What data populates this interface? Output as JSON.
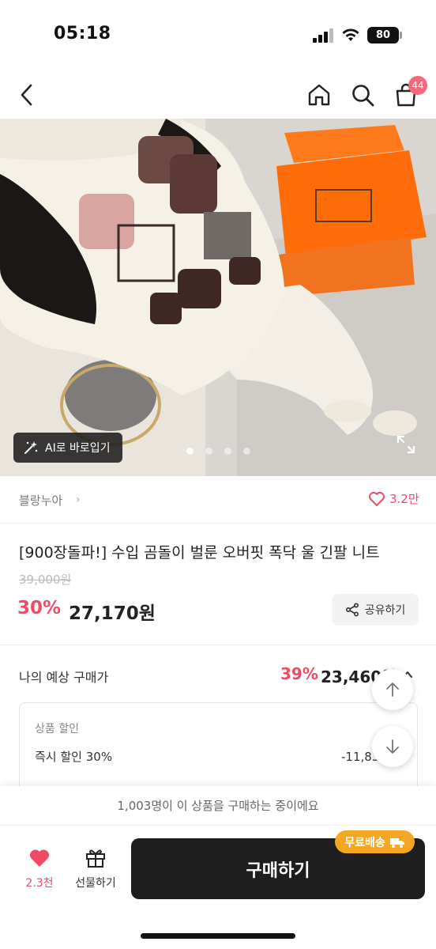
{
  "status_bar": {
    "time": "05:18",
    "battery": "80"
  },
  "header": {
    "back_icon": "chevron-left-icon",
    "home_icon": "home-icon",
    "search_icon": "search-icon",
    "cart_icon": "shopping-bag-icon",
    "cart_badge": "44"
  },
  "image": {
    "ai_button_label": "AI로 바로입기",
    "ai_icon": "magic-wand-icon",
    "carousel_total": 4,
    "carousel_active": 1,
    "expand_icon": "expand-icon"
  },
  "brand": {
    "name": "블랑누아",
    "chevron": "›",
    "like_count": "3.2만",
    "like_icon": "heart-outline-icon"
  },
  "product": {
    "title": "[900장돌파!] 수입 곰돌이 벌룬 오버핏 폭닥 울 긴팔 니트",
    "original_price": "39,000원",
    "discount": "30%",
    "price": "27,170원",
    "share_label": "공유하기"
  },
  "expected": {
    "label": "나의 예상 구매가",
    "discount": "39%",
    "price": "23,460원"
  },
  "discount_detail": {
    "section_title": "상품 할인",
    "items": [
      {
        "label": "즉시 할인 30%",
        "amount": "-11,830원"
      }
    ]
  },
  "bottom": {
    "buyers_text": "1,003명이 이 상품을 구매하는 중이에요",
    "wish_count": "2.3천",
    "gift_label": "선물하기",
    "buy_label": "구매하기",
    "free_shipping_label": "무료배송"
  },
  "colors": {
    "accent": "#f04a64",
    "buy_button": "#1e1e1e",
    "shipping_badge": "#f5a623"
  }
}
